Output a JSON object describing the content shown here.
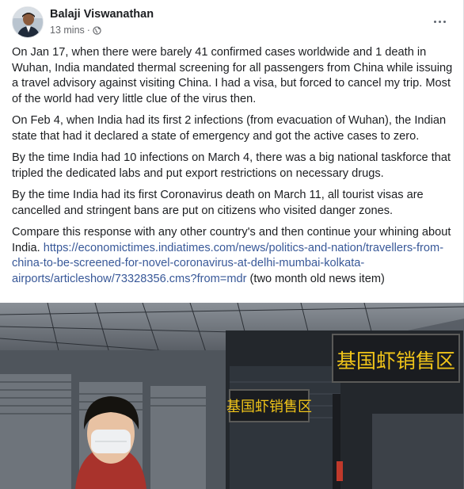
{
  "post": {
    "author": "Balaji Viswanathan",
    "timestamp": "13 mins",
    "separator": "·",
    "privacy_icon": "globe-icon",
    "more_icon": "more-options-icon",
    "paragraphs": [
      "On Jan 17, when there were barely 41 confirmed cases worldwide and 1 death in Wuhan, India mandated thermal screening for all passengers from China while issuing a travel advisory against visiting China. I had a visa, but forced to cancel my trip. Most of the world had very little clue of the virus then.",
      "On Feb 4, when India had its first 2 infections (from evacuation of Wuhan), the Indian state that had it declared a state of emergency and got the active cases to zero.",
      "By the time India had 10 infections on March 4, there was a big national taskforce that tripled the dedicated labs and put export restrictions on necessary drugs.",
      "By the time India had its first Coronavirus death on March 11, all tourist visas are cancelled and stringent bans are put on citizens who visited danger zones."
    ],
    "closing_text": " Compare this response with any other country's and then continue your whining about India. ",
    "link_text": "https://economictimes.indiatimes.com/news/politics-and-nation/travellers-from-china-to-be-screened-for-novel-coronavirus-at-delhi-mumbai-kolkata-airports/articleshow/73328356.cms?from=mdr",
    "link_suffix": " (two month old news item)",
    "photo": {
      "sign_text_1": "基国虾销售区",
      "sign_text_2": "基国虾销售区"
    }
  },
  "colors": {
    "text": "#1c1e21",
    "secondary_text": "#65676b",
    "link": "#385898",
    "sign_text": "#f0c419"
  }
}
